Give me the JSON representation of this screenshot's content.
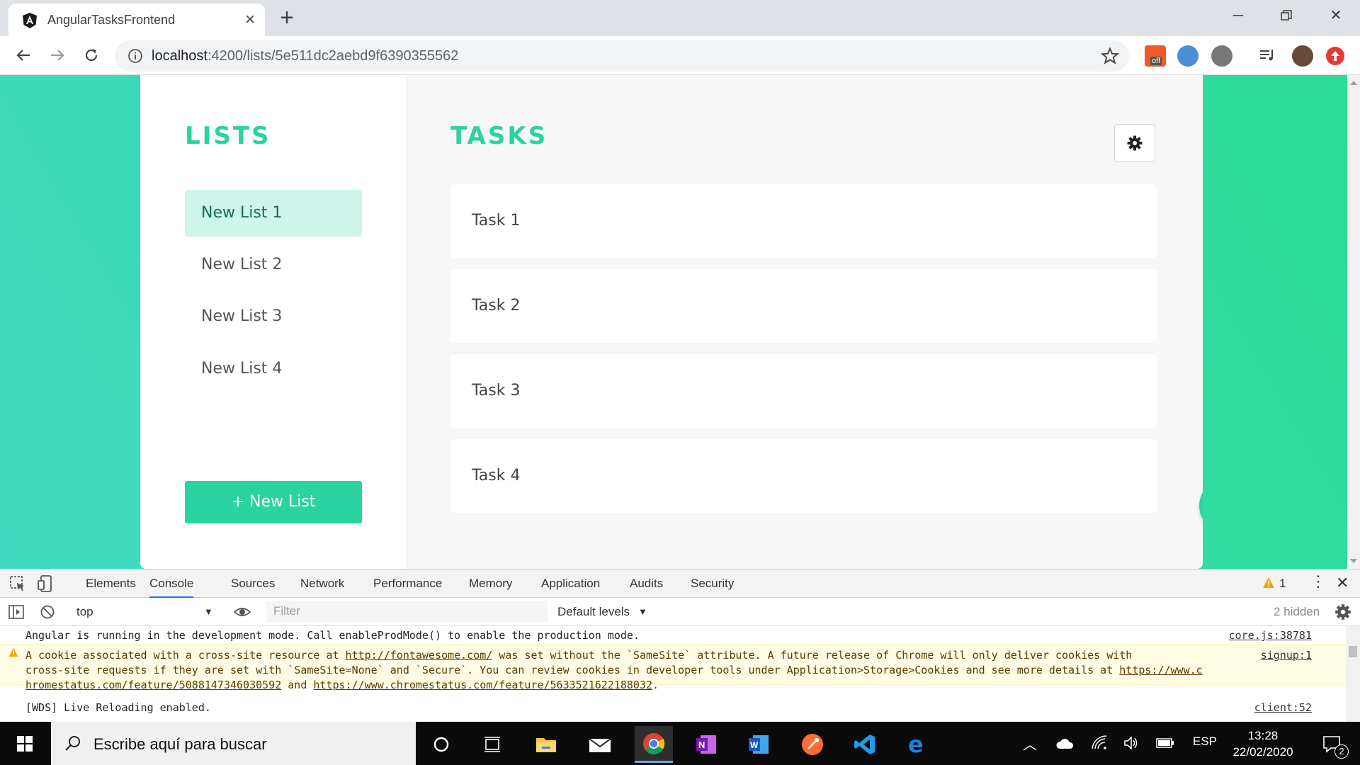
{
  "browser": {
    "tab_title": "AngularTasksFrontend",
    "url_host": "localhost",
    "url_path": ":4200/lists/5e511dc2aebd9f6390355562",
    "ext_badge": "off"
  },
  "app": {
    "lists_heading": "LISTS",
    "tasks_heading": "TASKS",
    "lists": [
      {
        "label": "New List 1"
      },
      {
        "label": "New List 2"
      },
      {
        "label": "New List 3"
      },
      {
        "label": "New List 4"
      }
    ],
    "active_list_index": 0,
    "new_list_button": "+ New List",
    "tasks": [
      {
        "label": "Task 1"
      },
      {
        "label": "Task 2"
      },
      {
        "label": "Task 3"
      },
      {
        "label": "Task 4"
      }
    ],
    "colors": {
      "accent": "#2ad3a0",
      "active_list_bg": "#cdf5ea",
      "bg_gradient_start": "#2bdb96",
      "bg_gradient_end": "#41dac0"
    }
  },
  "devtools": {
    "tabs": [
      "Elements",
      "Console",
      "Sources",
      "Network",
      "Performance",
      "Memory",
      "Application",
      "Audits",
      "Security"
    ],
    "active_tab": "Console",
    "warning_count": "1",
    "context": "top",
    "filter_placeholder": "Filter",
    "levels": "Default levels",
    "hidden": "2 hidden",
    "messages": [
      {
        "text": "Angular is running in the development mode. Call enableProdMode() to enable the production mode.",
        "source": "core.js:38781"
      },
      {
        "type": "warning",
        "pre1": "A cookie associated with a cross-site resource at ",
        "link1": "http://fontawesome.com/",
        "mid1": " was set without the `SameSite` attribute. A future release of Chrome will only deliver cookies with",
        "line2": "cross-site requests if they are set with `SameSite=None` and `Secure`. You can review cookies in developer tools under Application>Storage>Cookies and see more details at ",
        "link2": "https://www.c",
        "link2b": "hromestatus.com/feature/5088147346030592",
        "and": " and ",
        "link3": "https://www.chromestatus.com/feature/5633521622188032",
        "end": ".",
        "source": "signup:1"
      },
      {
        "text": "[WDS] Live Reloading enabled.",
        "source": "client:52"
      }
    ]
  },
  "taskbar": {
    "search_placeholder": "Escribe aquí para buscar",
    "language": "ESP",
    "time": "13:28",
    "date": "22/02/2020",
    "notifications": "2"
  }
}
